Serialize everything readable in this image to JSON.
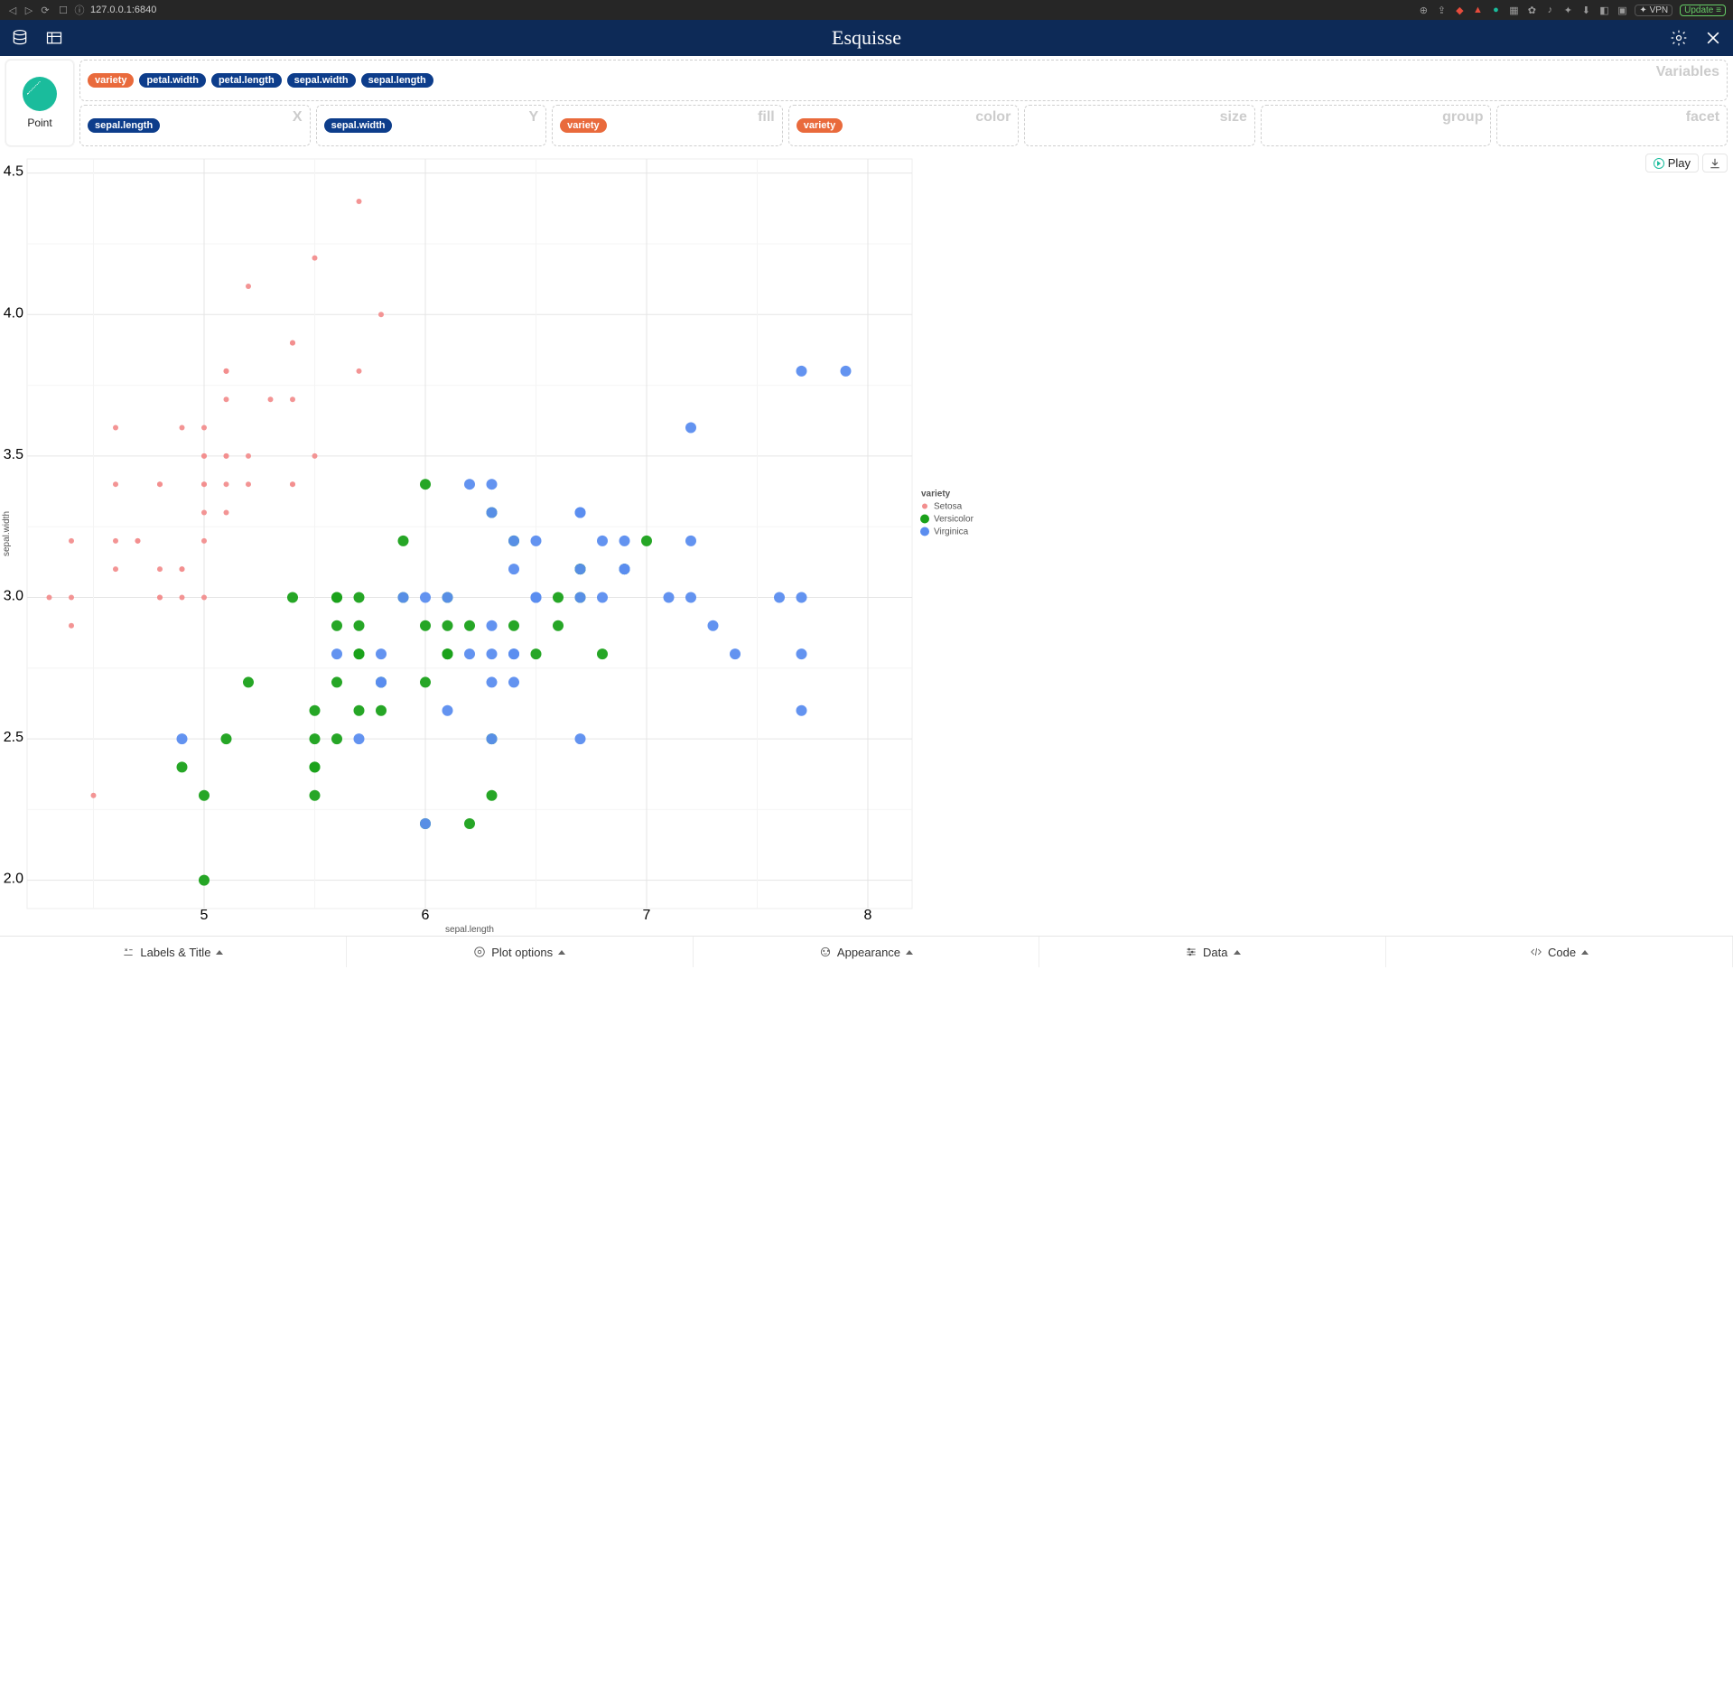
{
  "browser": {
    "url": "127.0.0.1:6840",
    "vpn": "VPN",
    "update": "Update"
  },
  "app": {
    "title": "Esquisse"
  },
  "geom": {
    "label": "Point"
  },
  "shelf_labels": {
    "variables": "Variables",
    "x": "X",
    "y": "Y",
    "fill": "fill",
    "color": "color",
    "size": "size",
    "group": "group",
    "facet": "facet"
  },
  "variable_pills": [
    {
      "label": "sepal.length",
      "kind": "blue"
    },
    {
      "label": "sepal.width",
      "kind": "blue"
    },
    {
      "label": "petal.length",
      "kind": "blue"
    },
    {
      "label": "petal.width",
      "kind": "blue"
    },
    {
      "label": "variety",
      "kind": "orange"
    }
  ],
  "aes": {
    "x": [
      {
        "label": "sepal.length",
        "kind": "blue"
      }
    ],
    "y": [
      {
        "label": "sepal.width",
        "kind": "blue"
      }
    ],
    "fill": [
      {
        "label": "variety",
        "kind": "orange"
      }
    ],
    "color": [
      {
        "label": "variety",
        "kind": "orange"
      }
    ],
    "size": [],
    "group": [],
    "facet": []
  },
  "plot_controls": {
    "play": "Play"
  },
  "bottom": [
    {
      "label": "Labels & Title"
    },
    {
      "label": "Plot options"
    },
    {
      "label": "Appearance"
    },
    {
      "label": "Data"
    },
    {
      "label": "Code"
    }
  ],
  "chart_data": {
    "type": "scatter",
    "xlabel": "sepal.length",
    "ylabel": "sepal.width",
    "legend_title": "variety",
    "xlim": [
      4.2,
      8.2
    ],
    "ylim": [
      1.9,
      4.55
    ],
    "x_ticks": [
      5,
      6,
      7,
      8
    ],
    "y_ticks": [
      2.0,
      2.5,
      3.0,
      3.5,
      4.0,
      4.5
    ],
    "series": [
      {
        "name": "Setosa",
        "color": "#f28e8e",
        "size": 3,
        "points": [
          [
            5.1,
            3.5
          ],
          [
            4.9,
            3.0
          ],
          [
            4.7,
            3.2
          ],
          [
            4.6,
            3.1
          ],
          [
            5.0,
            3.6
          ],
          [
            5.4,
            3.9
          ],
          [
            4.6,
            3.4
          ],
          [
            5.0,
            3.4
          ],
          [
            4.4,
            2.9
          ],
          [
            4.9,
            3.1
          ],
          [
            5.4,
            3.7
          ],
          [
            4.8,
            3.4
          ],
          [
            4.8,
            3.0
          ],
          [
            4.3,
            3.0
          ],
          [
            5.8,
            4.0
          ],
          [
            5.7,
            4.4
          ],
          [
            5.4,
            3.9
          ],
          [
            5.1,
            3.5
          ],
          [
            5.7,
            3.8
          ],
          [
            5.1,
            3.8
          ],
          [
            5.4,
            3.4
          ],
          [
            5.1,
            3.7
          ],
          [
            4.6,
            3.6
          ],
          [
            5.1,
            3.3
          ],
          [
            4.8,
            3.4
          ],
          [
            5.0,
            3.0
          ],
          [
            5.0,
            3.4
          ],
          [
            5.2,
            3.5
          ],
          [
            5.2,
            3.4
          ],
          [
            4.7,
            3.2
          ],
          [
            4.8,
            3.1
          ],
          [
            5.4,
            3.4
          ],
          [
            5.2,
            4.1
          ],
          [
            5.5,
            4.2
          ],
          [
            4.9,
            3.1
          ],
          [
            5.0,
            3.2
          ],
          [
            5.5,
            3.5
          ],
          [
            4.9,
            3.6
          ],
          [
            4.4,
            3.0
          ],
          [
            5.1,
            3.4
          ],
          [
            5.0,
            3.5
          ],
          [
            4.5,
            2.3
          ],
          [
            4.4,
            3.2
          ],
          [
            5.0,
            3.5
          ],
          [
            5.1,
            3.8
          ],
          [
            4.8,
            3.0
          ],
          [
            5.1,
            3.8
          ],
          [
            4.6,
            3.2
          ],
          [
            5.3,
            3.7
          ],
          [
            5.0,
            3.3
          ]
        ]
      },
      {
        "name": "Versicolor",
        "color": "#1aa11a",
        "size": 6,
        "points": [
          [
            7.0,
            3.2
          ],
          [
            6.4,
            3.2
          ],
          [
            6.9,
            3.1
          ],
          [
            5.5,
            2.3
          ],
          [
            6.5,
            2.8
          ],
          [
            5.7,
            2.8
          ],
          [
            6.3,
            3.3
          ],
          [
            4.9,
            2.4
          ],
          [
            6.6,
            2.9
          ],
          [
            5.2,
            2.7
          ],
          [
            5.0,
            2.0
          ],
          [
            5.9,
            3.0
          ],
          [
            6.0,
            2.2
          ],
          [
            6.1,
            2.9
          ],
          [
            5.6,
            2.9
          ],
          [
            6.7,
            3.1
          ],
          [
            5.6,
            3.0
          ],
          [
            5.8,
            2.7
          ],
          [
            6.2,
            2.2
          ],
          [
            5.6,
            2.5
          ],
          [
            5.9,
            3.2
          ],
          [
            6.1,
            2.8
          ],
          [
            6.3,
            2.5
          ],
          [
            6.1,
            2.8
          ],
          [
            6.4,
            2.9
          ],
          [
            6.6,
            3.0
          ],
          [
            6.8,
            2.8
          ],
          [
            6.7,
            3.0
          ],
          [
            6.0,
            2.9
          ],
          [
            5.7,
            2.6
          ],
          [
            5.5,
            2.4
          ],
          [
            5.5,
            2.4
          ],
          [
            5.8,
            2.7
          ],
          [
            6.0,
            2.7
          ],
          [
            5.4,
            3.0
          ],
          [
            6.0,
            3.4
          ],
          [
            6.7,
            3.1
          ],
          [
            6.3,
            2.3
          ],
          [
            5.6,
            3.0
          ],
          [
            5.5,
            2.5
          ],
          [
            5.5,
            2.6
          ],
          [
            6.1,
            3.0
          ],
          [
            5.8,
            2.6
          ],
          [
            5.0,
            2.3
          ],
          [
            5.6,
            2.7
          ],
          [
            5.7,
            3.0
          ],
          [
            5.7,
            2.9
          ],
          [
            6.2,
            2.9
          ],
          [
            5.1,
            2.5
          ],
          [
            5.7,
            2.8
          ]
        ]
      },
      {
        "name": "Virginica",
        "color": "#5b8def",
        "size": 6,
        "points": [
          [
            6.3,
            3.3
          ],
          [
            5.8,
            2.7
          ],
          [
            7.1,
            3.0
          ],
          [
            6.3,
            2.9
          ],
          [
            6.5,
            3.0
          ],
          [
            7.6,
            3.0
          ],
          [
            4.9,
            2.5
          ],
          [
            7.3,
            2.9
          ],
          [
            6.7,
            2.5
          ],
          [
            7.2,
            3.6
          ],
          [
            6.5,
            3.2
          ],
          [
            6.4,
            2.7
          ],
          [
            6.8,
            3.0
          ],
          [
            5.7,
            2.5
          ],
          [
            5.8,
            2.8
          ],
          [
            6.4,
            3.2
          ],
          [
            6.5,
            3.0
          ],
          [
            7.7,
            3.8
          ],
          [
            7.7,
            2.6
          ],
          [
            6.0,
            2.2
          ],
          [
            6.9,
            3.2
          ],
          [
            5.6,
            2.8
          ],
          [
            7.7,
            2.8
          ],
          [
            6.3,
            2.7
          ],
          [
            6.7,
            3.3
          ],
          [
            7.2,
            3.2
          ],
          [
            6.2,
            2.8
          ],
          [
            6.1,
            3.0
          ],
          [
            6.4,
            2.8
          ],
          [
            7.2,
            3.0
          ],
          [
            7.4,
            2.8
          ],
          [
            7.9,
            3.8
          ],
          [
            6.4,
            2.8
          ],
          [
            6.3,
            2.8
          ],
          [
            6.1,
            2.6
          ],
          [
            7.7,
            3.0
          ],
          [
            6.3,
            3.4
          ],
          [
            6.4,
            3.1
          ],
          [
            6.0,
            3.0
          ],
          [
            6.9,
            3.1
          ],
          [
            6.7,
            3.1
          ],
          [
            6.9,
            3.1
          ],
          [
            5.8,
            2.7
          ],
          [
            6.8,
            3.2
          ],
          [
            6.7,
            3.3
          ],
          [
            6.7,
            3.0
          ],
          [
            6.3,
            2.5
          ],
          [
            6.5,
            3.0
          ],
          [
            6.2,
            3.4
          ],
          [
            5.9,
            3.0
          ]
        ]
      }
    ]
  }
}
